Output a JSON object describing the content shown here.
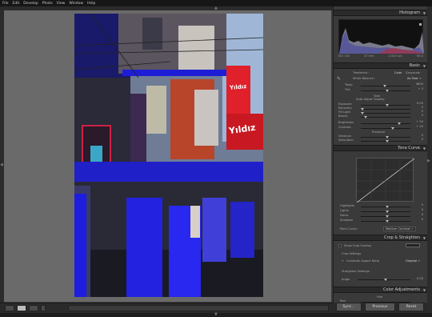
{
  "menu": [
    "File",
    "Edit",
    "Develop",
    "Photo",
    "View",
    "Window",
    "Help"
  ],
  "panels": {
    "histogram": {
      "title": "Histogram",
      "readout": [
        "ISO 100",
        "37 mm",
        "1/320 sec",
        "f/8.0"
      ]
    },
    "basic": {
      "title": "Basic",
      "treatment_label": "Treatment :",
      "color": "Color",
      "grayscale": "Grayscale",
      "wb_label": "White Balance :",
      "wb_value": "As Shot ÷",
      "temp": "Temp",
      "temp_val": "4650",
      "tint": "Tint",
      "tint_val": "+ 3",
      "tone_label": "Tone",
      "auto_tone": "Auto  Adjust Tonality",
      "exposure": "Exposure",
      "exposure_val": "0.00",
      "recovery": "Recovery",
      "recovery_val": "0",
      "fill": "Fill Light",
      "fill_val": "0",
      "blacks": "Blacks",
      "blacks_val": "5",
      "brightness": "Brightness",
      "brightness_val": "+ 50",
      "contrast": "Contrast",
      "contrast_val": "+ 25",
      "presence": "Presence",
      "vibrance": "Vibrance",
      "vibrance_val": "0",
      "saturation": "Saturation",
      "saturation_val": "0"
    },
    "tone_curve": {
      "title": "Tone Curve",
      "highlights": "Highlights",
      "highlights_val": "0",
      "lights": "Lights",
      "lights_val": "0",
      "darks": "Darks",
      "darks_val": "0",
      "shadows": "Shadows",
      "shadows_val": "0",
      "point_curve": "Point Curve :",
      "point_curve_val": "Medium Contrast ÷"
    },
    "crop": {
      "title": "Crop & Straighten",
      "show_overlay": "Show Crop Overlay",
      "crop_settings": "Crop Settings",
      "constrain": "Constrain Aspect Ratio",
      "constrain_val": "Original ÷",
      "straighten": "Straighten Settings",
      "angle": "Angle",
      "angle_val": "0.00"
    },
    "color_adj": {
      "title": "Color Adjustments",
      "hue": "Hue",
      "red": "Red"
    }
  },
  "buttons": {
    "sync": "Sync...",
    "previous": "Previous",
    "reset": "Reset"
  },
  "photo_signs": {
    "sign1": "Yıldız",
    "sign2": "Yıldız"
  }
}
